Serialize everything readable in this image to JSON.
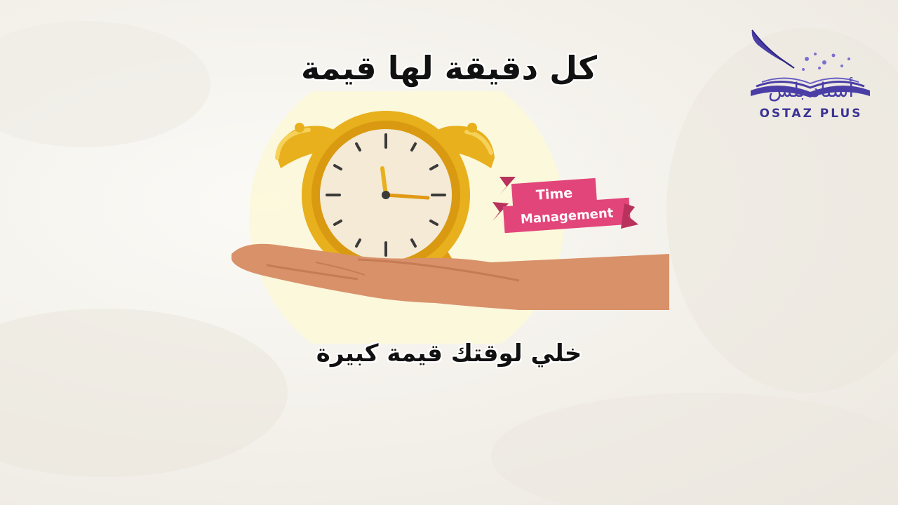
{
  "headline": "كل دقيقة لها قيمة",
  "subline": "خلي لوقتك قيمة كبيرة",
  "banner": {
    "line1": "Time",
    "line2": "Management"
  },
  "logo": {
    "arabic": "أستاذ بلس",
    "english": "OSTAZ PLUS",
    "icon": "open-book-quill-icon"
  },
  "illustration": {
    "icon": "alarm-clock-on-hand-icon"
  },
  "colors": {
    "clock_gold": "#e8b01d",
    "banner_pink": "#e2457a",
    "hand_skin": "#d99169",
    "logo_purple": "#4a3ea6",
    "halo": "#fbf8d8"
  }
}
